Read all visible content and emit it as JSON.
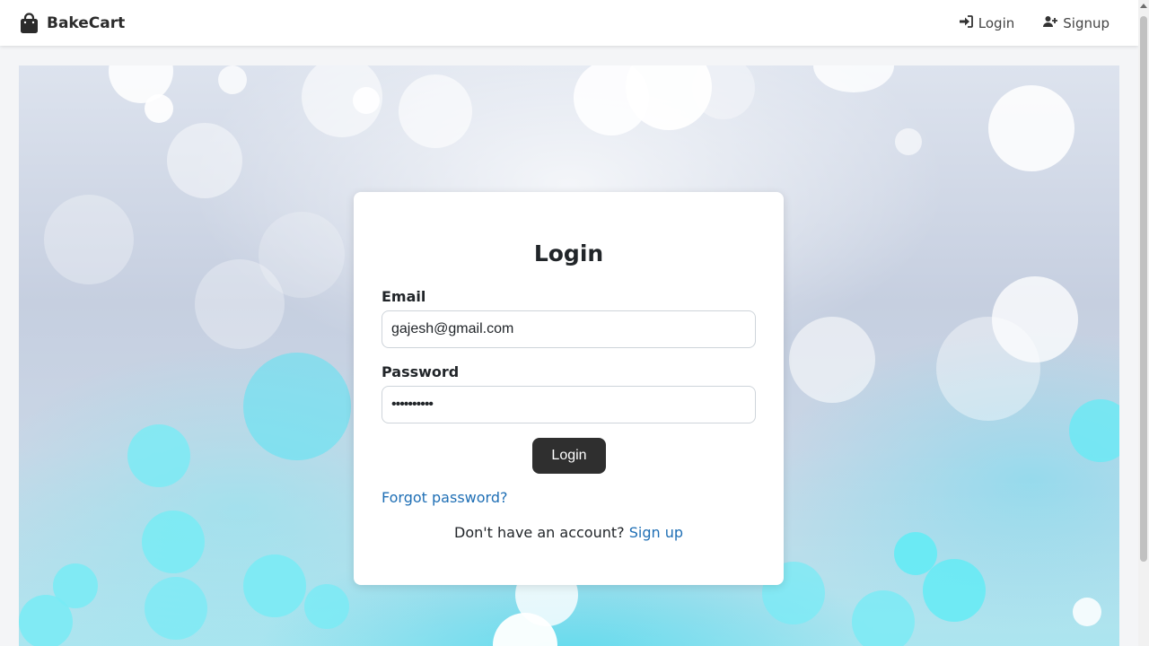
{
  "brand": {
    "name": "BakeCart",
    "icon": "shopping-bag-icon"
  },
  "nav": {
    "login_label": "Login",
    "login_icon": "sign-in-icon",
    "signup_label": "Signup",
    "signup_icon": "user-plus-icon"
  },
  "form": {
    "title": "Login",
    "email_label": "Email",
    "email_value": "gajesh@gmail.com",
    "password_label": "Password",
    "password_value": "••••••••••",
    "submit_label": "Login",
    "forgot_label": "Forgot password?",
    "no_account_text": "Don't have an account?",
    "signup_link": "Sign up"
  },
  "colors": {
    "link": "#1f6fb5",
    "button": "#2f2f2f",
    "hero_accent": "#3fe0f0"
  }
}
